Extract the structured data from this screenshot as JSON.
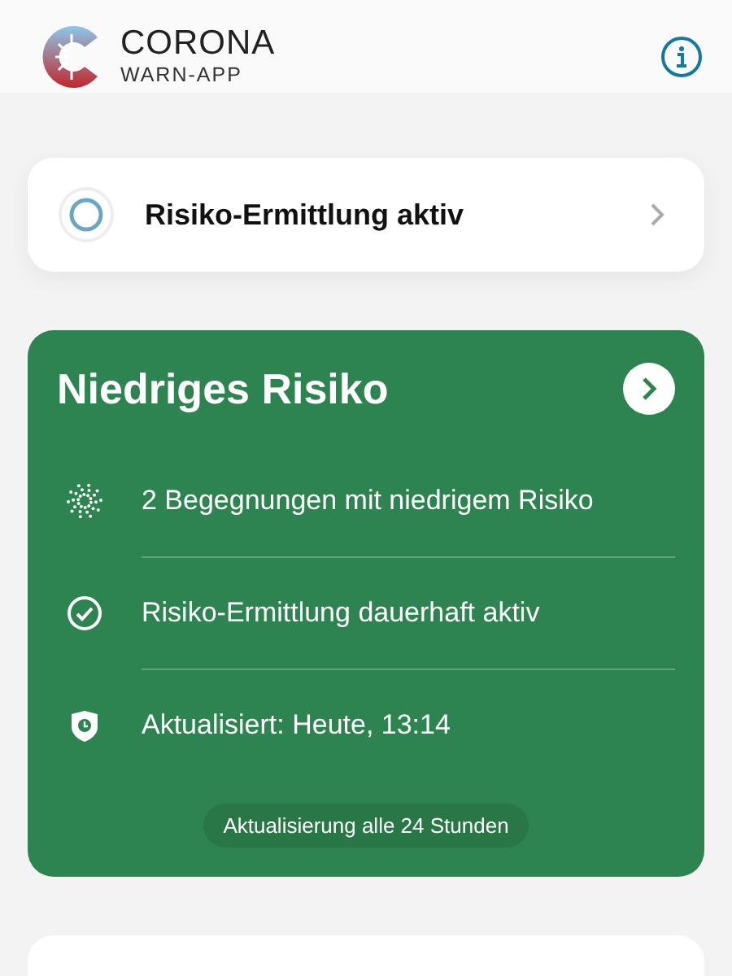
{
  "header": {
    "logo_title": "CORONA",
    "logo_subtitle": "WARN-APP"
  },
  "status_card": {
    "label": "Risiko-Ermittlung aktiv"
  },
  "risk_card": {
    "title": "Niedriges Risiko",
    "items": [
      {
        "kind": "encounters",
        "text": "2 Begegnungen mit niedrigem Risiko"
      },
      {
        "kind": "check",
        "text": "Risiko-Ermittlung dauerhaft aktiv"
      },
      {
        "kind": "shield",
        "text": "Aktualisiert: Heute, 13:14"
      }
    ],
    "footer": "Aktualisierung alle 24 Stunden"
  }
}
